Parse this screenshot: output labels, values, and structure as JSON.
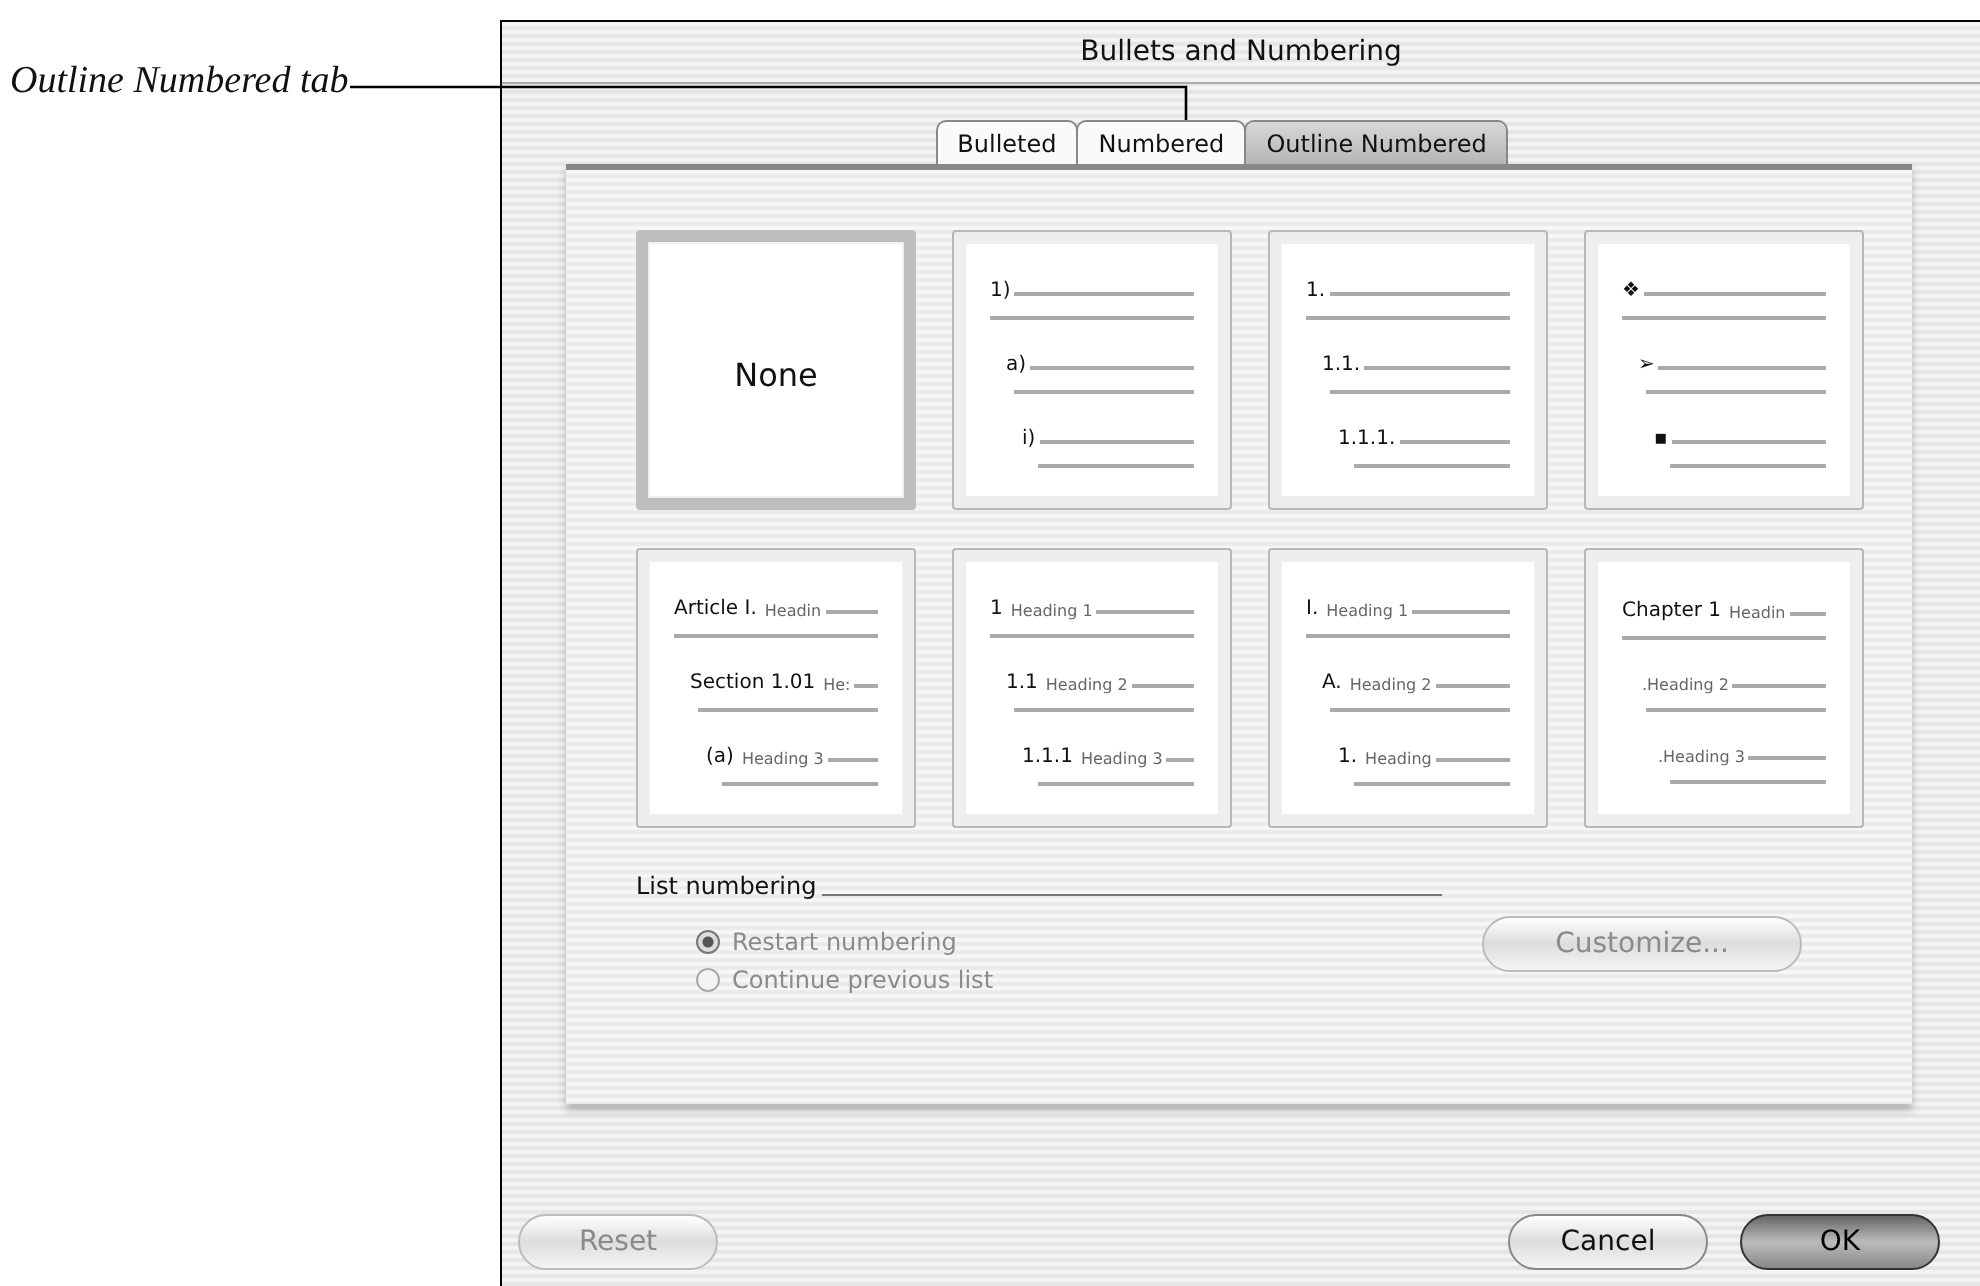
{
  "callout": {
    "label": "Outline Numbered tab"
  },
  "window": {
    "title": "Bullets and Numbering"
  },
  "tabs": [
    {
      "label": "Bulleted",
      "selected": false
    },
    {
      "label": "Numbered",
      "selected": false
    },
    {
      "label": "Outline Numbered",
      "selected": true
    }
  ],
  "tiles": [
    {
      "kind": "none",
      "label": "None",
      "selected": true
    },
    {
      "kind": "outline",
      "selected": false,
      "rows": [
        {
          "marker": "1)"
        },
        {
          "marker": "a)"
        },
        {
          "marker": "i)"
        }
      ]
    },
    {
      "kind": "outline",
      "selected": false,
      "rows": [
        {
          "marker": "1."
        },
        {
          "marker": "1.1."
        },
        {
          "marker": "1.1.1."
        }
      ]
    },
    {
      "kind": "outline",
      "selected": false,
      "rows": [
        {
          "marker": "❖"
        },
        {
          "marker": "➢"
        },
        {
          "marker": "▪"
        }
      ]
    },
    {
      "kind": "outline",
      "selected": false,
      "rows": [
        {
          "marker": "Article I.",
          "heading": "Headin"
        },
        {
          "marker": "Section 1.01",
          "heading": "He:"
        },
        {
          "marker": "(a)",
          "heading": "Heading 3"
        }
      ]
    },
    {
      "kind": "outline",
      "selected": false,
      "rows": [
        {
          "marker": "1",
          "heading": "Heading 1"
        },
        {
          "marker": "1.1",
          "heading": "Heading 2"
        },
        {
          "marker": "1.1.1",
          "heading": "Heading 3"
        }
      ]
    },
    {
      "kind": "outline",
      "selected": false,
      "rows": [
        {
          "marker": "I.",
          "heading": "Heading 1"
        },
        {
          "marker": "A.",
          "heading": "Heading 2"
        },
        {
          "marker": "1.",
          "heading": "Heading"
        }
      ]
    },
    {
      "kind": "outline",
      "selected": false,
      "rows": [
        {
          "marker": "Chapter 1",
          "heading": "Headin"
        },
        {
          "marker": "",
          "heading": ".Heading 2"
        },
        {
          "marker": "",
          "heading": ".Heading 3"
        }
      ]
    }
  ],
  "list_numbering": {
    "label": "List numbering",
    "options": [
      {
        "label": "Restart numbering",
        "selected": true,
        "disabled": true
      },
      {
        "label": "Continue previous list",
        "selected": false,
        "disabled": true
      }
    ],
    "customize": {
      "label": "Customize...",
      "disabled": true
    }
  },
  "buttons": [
    {
      "label": "Reset",
      "kind": "plain",
      "disabled": true
    },
    {
      "label": "Cancel",
      "kind": "plain",
      "disabled": false
    },
    {
      "label": "OK",
      "kind": "default",
      "disabled": false
    }
  ]
}
